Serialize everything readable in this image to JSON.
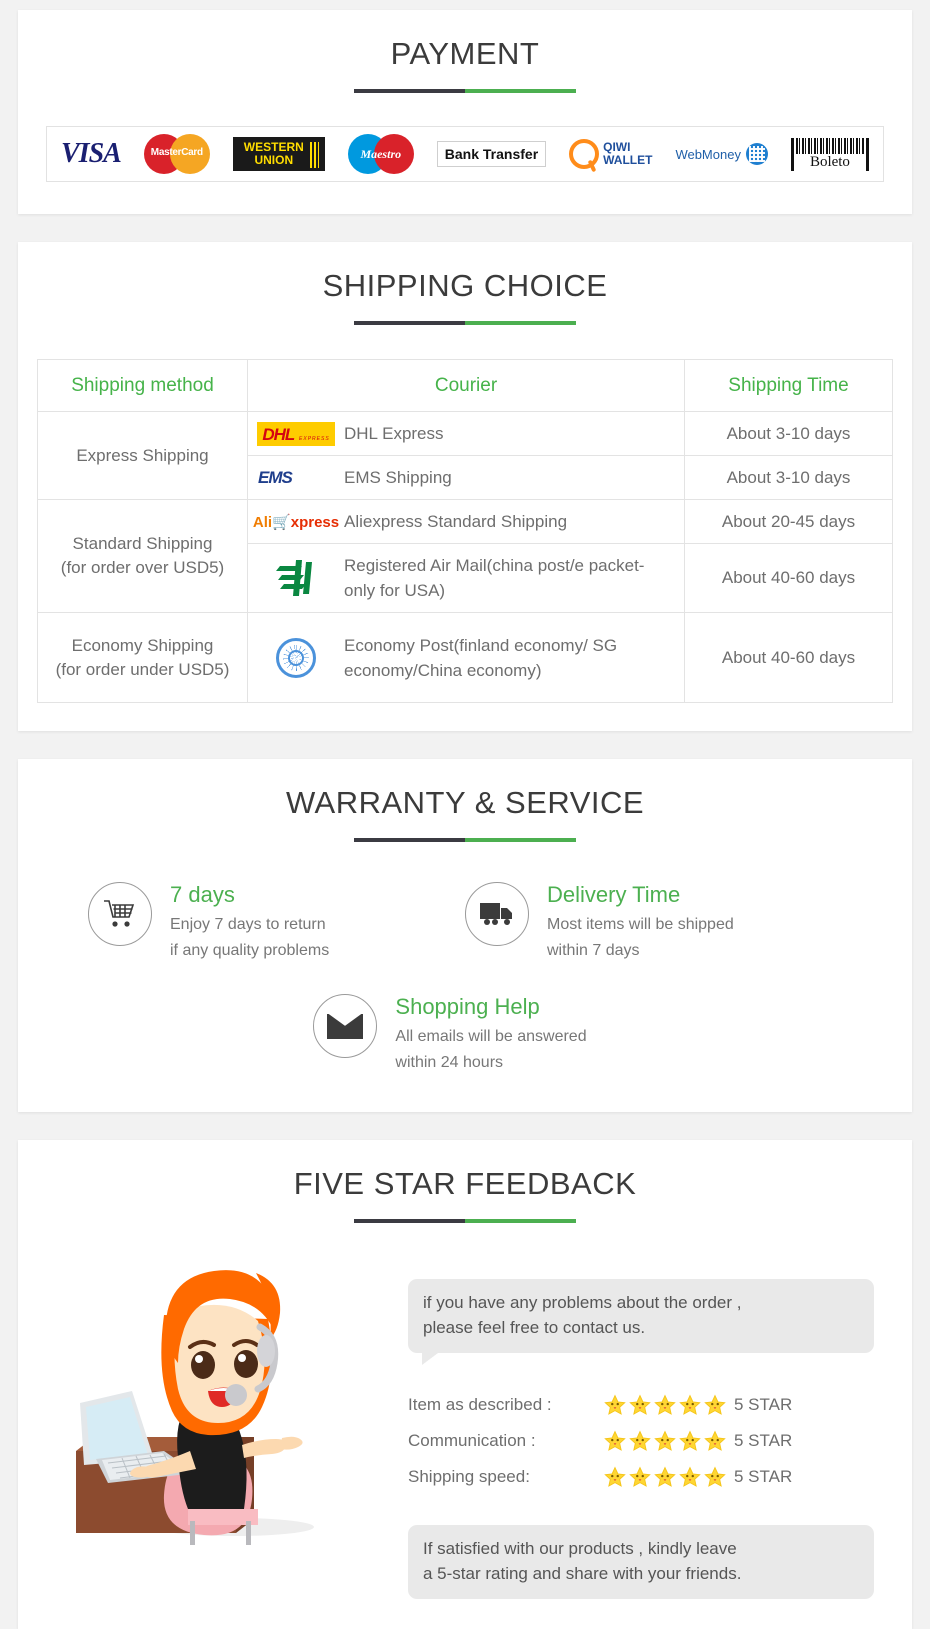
{
  "payment": {
    "title": "PAYMENT",
    "methods": [
      {
        "name": "visa",
        "label": "VISA"
      },
      {
        "name": "mastercard",
        "label": "MasterCard"
      },
      {
        "name": "western-union",
        "label_line1": "WESTERN",
        "label_line2": "UNION"
      },
      {
        "name": "maestro",
        "label": "Maestro"
      },
      {
        "name": "bank-transfer",
        "label": "Bank Transfer"
      },
      {
        "name": "qiwi-wallet",
        "label_line1": "QIWI",
        "label_line2": "WALLET"
      },
      {
        "name": "webmoney",
        "label": "WebMoney"
      },
      {
        "name": "boleto",
        "label": "Boleto"
      }
    ]
  },
  "shipping": {
    "title": "SHIPPING CHOICE",
    "headers": {
      "method": "Shipping method",
      "courier": "Courier",
      "time": "Shipping Time"
    },
    "groups": [
      {
        "method": "Express Shipping",
        "rows": [
          {
            "logo": "dhl",
            "logo_text": "DHL",
            "logo_sub": "EXPRESS",
            "courier": "DHL Express",
            "time": "About 3-10 days"
          },
          {
            "logo": "ems",
            "logo_text": "EMS",
            "courier": "EMS Shipping",
            "time": "About 3-10 days"
          }
        ]
      },
      {
        "method": "Standard Shipping\n(for order over USD5)",
        "method_line1": "Standard Shipping",
        "method_line2": "(for order over USD5)",
        "rows": [
          {
            "logo": "aliexpress",
            "logo_text_a": "Ali",
            "logo_text_b": "xpress",
            "courier": "Aliexpress Standard Shipping",
            "time": "About 20-45 days"
          },
          {
            "logo": "china-post",
            "courier": "Registered Air Mail(china post/e packet-only for USA)",
            "time": "About 40-60 days"
          }
        ]
      },
      {
        "method_line1": "Economy Shipping",
        "method_line2": "(for order under USD5)",
        "rows": [
          {
            "logo": "united-nations",
            "courier": "Economy Post(finland economy/ SG economy/China economy)",
            "time": "About 40-60 days"
          }
        ]
      }
    ]
  },
  "warranty": {
    "title": "WARRANTY & SERVICE",
    "items": [
      {
        "icon": "shopping-cart-icon",
        "title": "7 days",
        "line1": "Enjoy 7 days to return",
        "line2": "if any quality problems"
      },
      {
        "icon": "delivery-truck-icon",
        "title": "Delivery Time",
        "line1": "Most items will be shipped",
        "line2": "within 7 days"
      },
      {
        "icon": "envelope-icon",
        "title": "Shopping Help",
        "line1": "All emails will be answered",
        "line2": "within 24 hours"
      }
    ]
  },
  "feedback": {
    "title": "FIVE STAR FEEDBACK",
    "bubble_top_line1": "if you have any problems about the order ,",
    "bubble_top_line2": "please feel free to contact us.",
    "ratings": [
      {
        "label": "Item as described :",
        "stars": 5,
        "score": "5 STAR"
      },
      {
        "label": "Communication :",
        "stars": 5,
        "score": "5 STAR"
      },
      {
        "label": "Shipping speed:",
        "stars": 5,
        "score": "5 STAR"
      }
    ],
    "bubble_bottom_line1": "If satisfied with our products , kindly leave",
    "bubble_bottom_line2": "a 5-star rating and share with your friends."
  },
  "colors": {
    "accent_green": "#4caf50",
    "heading_dark": "#3b3b42",
    "body_gray": "#6e6e6e",
    "page_bg": "#f2f2f2",
    "star_yellow": "#ffd633"
  }
}
